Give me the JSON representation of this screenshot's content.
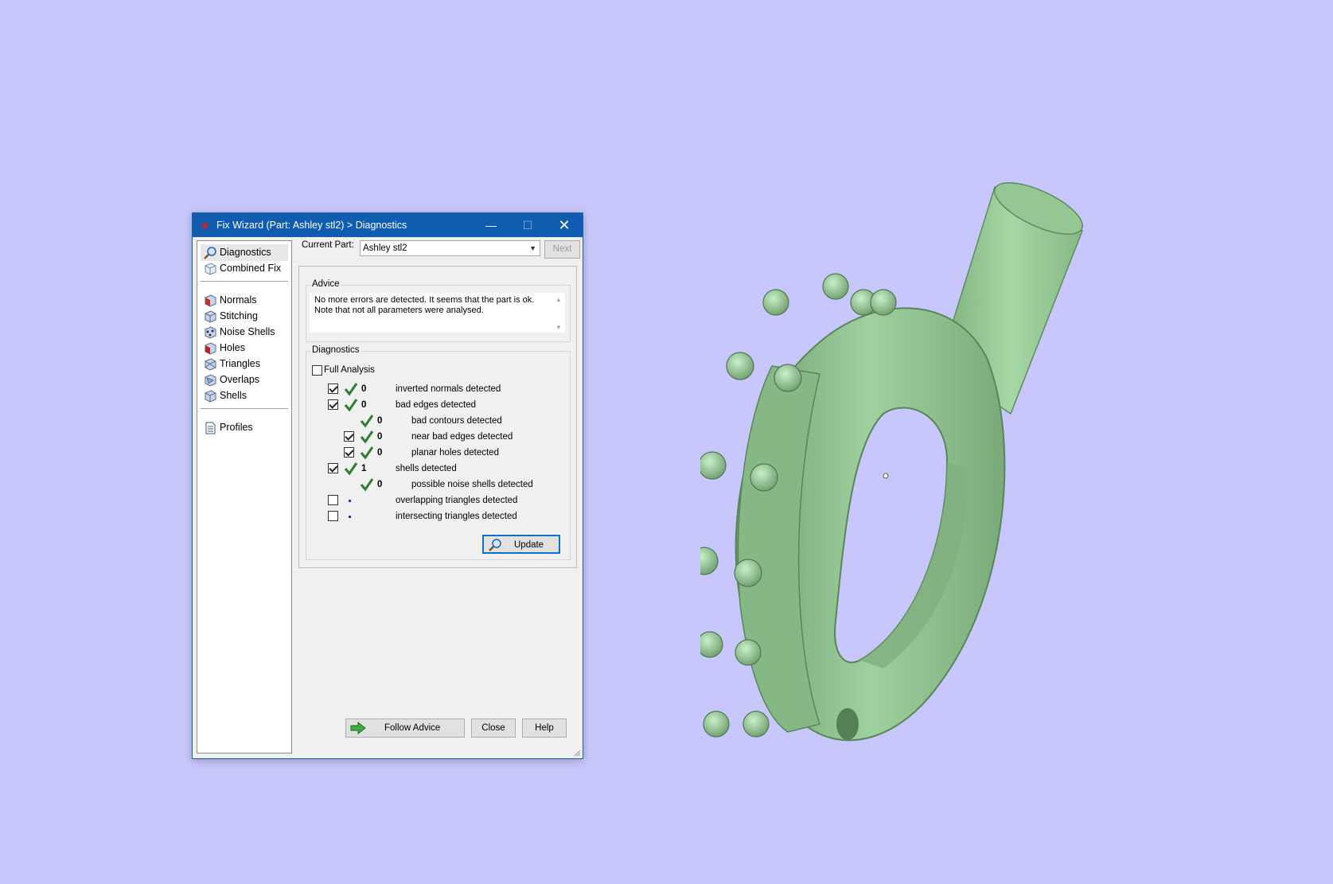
{
  "window": {
    "title": "Fix Wizard (Part: Ashley stl2) > Diagnostics",
    "minimize_glyph": "—",
    "maximize_glyph": "☐",
    "close_glyph": "✕"
  },
  "nav": {
    "items": [
      {
        "label": "Diagnostics",
        "icon": "magnifier-icon",
        "selected": true
      },
      {
        "label": "Combined Fix",
        "icon": "cube-icon"
      },
      {
        "label": "Normals",
        "icon": "normals-cube-icon"
      },
      {
        "label": "Stitching",
        "icon": "stitching-cube-icon"
      },
      {
        "label": "Noise Shells",
        "icon": "noise-shells-icon"
      },
      {
        "label": "Holes",
        "icon": "holes-cube-icon"
      },
      {
        "label": "Triangles",
        "icon": "triangles-cube-icon"
      },
      {
        "label": "Overlaps",
        "icon": "overlaps-cube-icon"
      },
      {
        "label": "Shells",
        "icon": "shells-cube-icon"
      },
      {
        "label": "Profiles",
        "icon": "document-icon"
      }
    ]
  },
  "current_part": {
    "label": "Current Part:",
    "value": "Ashley stl2",
    "next_label": "Next"
  },
  "advice": {
    "title": "Advice",
    "text": "No more errors are detected. It seems that the part is ok. Note that not all parameters were analysed."
  },
  "diagnostics": {
    "title": "Diagnostics",
    "full_analysis_label": "Full Analysis",
    "full_analysis_checked": false,
    "rows": [
      {
        "checkbox": true,
        "checked": true,
        "status": "ok",
        "count": "0",
        "label": "inverted normals detected",
        "indent": 0
      },
      {
        "checkbox": true,
        "checked": true,
        "status": "ok",
        "count": "0",
        "label": "bad edges detected",
        "indent": 0
      },
      {
        "checkbox": false,
        "checked": false,
        "status": "ok",
        "count": "0",
        "label": "bad contours detected",
        "indent": 1
      },
      {
        "checkbox": true,
        "checked": true,
        "status": "ok",
        "count": "0",
        "label": "near bad edges detected",
        "indent": 1
      },
      {
        "checkbox": true,
        "checked": true,
        "status": "ok",
        "count": "0",
        "label": "planar holes detected",
        "indent": 1
      },
      {
        "checkbox": true,
        "checked": true,
        "status": "ok",
        "count": "1",
        "label": "shells detected",
        "indent": 0
      },
      {
        "checkbox": false,
        "checked": false,
        "status": "ok",
        "count": "0",
        "label": "possible noise shells detected",
        "indent": 1
      },
      {
        "checkbox": true,
        "checked": false,
        "status": "none",
        "count": "",
        "label": "overlapping triangles detected",
        "indent": 0
      },
      {
        "checkbox": true,
        "checked": false,
        "status": "none",
        "count": "",
        "label": "intersecting triangles detected",
        "indent": 0
      }
    ],
    "update_label": "Update"
  },
  "footer": {
    "follow_advice_label": "Follow Advice",
    "close_label": "Close",
    "help_label": "Help"
  },
  "colors": {
    "background": "#c7c7fb",
    "title_bar": "#0f5cb0",
    "ok_check": "#2e7d32",
    "model": "#8fc48f"
  }
}
